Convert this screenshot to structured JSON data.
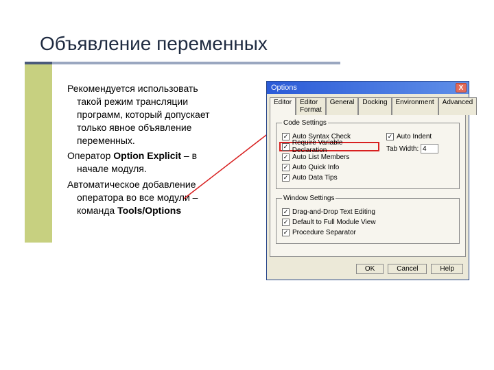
{
  "title": "Объявление переменных",
  "body": {
    "p1a": "Рекомендуется использовать",
    "p1b": "такой режим трансляции",
    "p1c": "программ, который допускает",
    "p1d": "только явное объявление",
    "p1e": "переменных.",
    "p2a": "Оператор ",
    "p2b_bold": "Option Explicit",
    "p2c": " – в",
    "p2d": "начале модуля.",
    "p3a": "Автоматическое добавление",
    "p3b": "оператора во все модули –",
    "p3c": "команда ",
    "p3c_bold": "Tools/Options"
  },
  "dialog": {
    "title": "Options",
    "close": "X",
    "tabs": {
      "t0": "Editor",
      "t1": "Editor Format",
      "t2": "General",
      "t3": "Docking",
      "t4": "Environment",
      "t5": "Advanced"
    },
    "code_settings_legend": "Code Settings",
    "checks": {
      "auto_syntax": "Auto Syntax Check",
      "require_var": "Require Variable Declaration",
      "auto_list": "Auto List Members",
      "auto_quick": "Auto Quick Info",
      "auto_data": "Auto Data Tips",
      "auto_indent": "Auto Indent"
    },
    "tab_width_label": "Tab Width:",
    "tab_width_value": "4",
    "window_settings_legend": "Window Settings",
    "win_checks": {
      "drag": "Drag-and-Drop Text Editing",
      "default_full": "Default to Full Module View",
      "procsep": "Procedure Separator"
    },
    "buttons": {
      "ok": "OK",
      "cancel": "Cancel",
      "help": "Help"
    }
  }
}
